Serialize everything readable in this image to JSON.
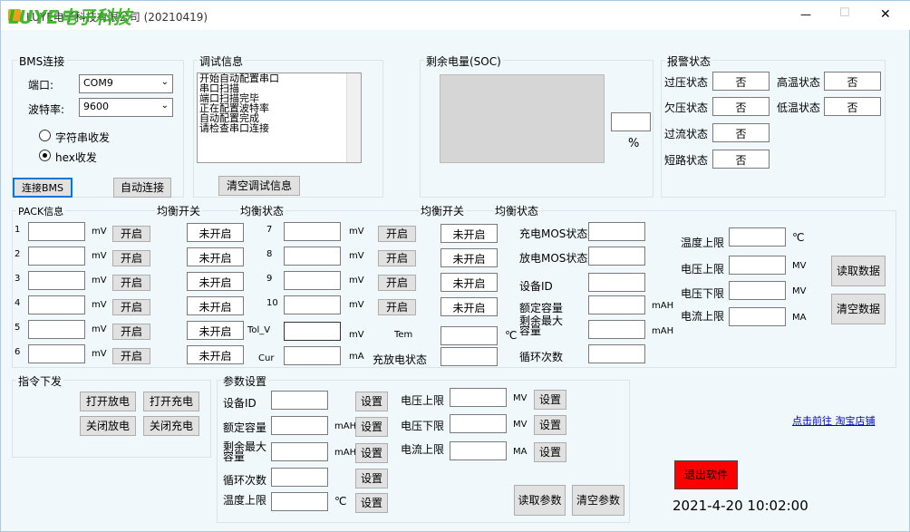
{
  "title": {
    "text": "LUYE电子科技有限公司 (20210419)",
    "watermark": "LUYE电子科技"
  },
  "window_controls": {
    "minimize": "—",
    "maximize": "☐",
    "close": "✕"
  },
  "bms": {
    "label": "BMS连接",
    "port_label": "端口:",
    "port_value": "COM9",
    "baud_label": "波特率:",
    "baud_value": "9600",
    "radio_string": "字符串收发",
    "radio_hex": "hex收发",
    "connect": "连接BMS",
    "auto_connect": "自动连接"
  },
  "debug": {
    "label": "调试信息",
    "lines": [
      "开始自动配置串口",
      "串口扫描",
      "端口扫描完毕",
      "正在配置波特率",
      "自动配置完成",
      "请检查串口连接"
    ],
    "clear": "清空调试信息"
  },
  "soc": {
    "label": "剩余电量(SOC)",
    "unit": "%"
  },
  "alarm": {
    "label": "报警状态",
    "overvolt": "过压状态",
    "overvolt_v": "否",
    "hightemp": "高温状态",
    "hightemp_v": "否",
    "undervolt": "欠压状态",
    "undervolt_v": "否",
    "lowtemp": "低温状态",
    "lowtemp_v": "否",
    "overcurr": "过流状态",
    "overcurr_v": "否",
    "short": "短路状态",
    "short_v": "否"
  },
  "pack": {
    "label": "PACK信息",
    "balance_switch": "均衡开关",
    "balance_state": "均衡状态",
    "unit_mv": "mV",
    "unit_ma": "mA",
    "on": "开启",
    "off_state": "未开启",
    "left_nums": [
      "1",
      "2",
      "3",
      "4",
      "5",
      "6"
    ],
    "right_nums": [
      "7",
      "8",
      "9",
      "10"
    ],
    "tol": "Tol_V",
    "cur": "Cur",
    "tem": "Tem",
    "tem_unit": "℃",
    "charge_state": "充放电状态",
    "charge_mos": "充电MOS状态",
    "discharge_mos": "放电MOS状态",
    "device_id": "设备ID",
    "rated": "额定容量",
    "remain": "剩余最大容量",
    "remain1": "剩余最大",
    "remain2": "容量",
    "cycles": "循环次数",
    "mah": "mAH",
    "temp_upper": "温度上限",
    "temp_unit": "℃",
    "volt_upper": "电压上限",
    "volt_lower": "电压下限",
    "curr_upper": "电流上限",
    "mv": "MV",
    "ma": "MA",
    "read": "读取数据",
    "clear": "清空数据"
  },
  "cmd": {
    "label": "指令下发",
    "open_discharge": "打开放电",
    "open_charge": "打开充电",
    "close_discharge": "关闭放电",
    "close_charge": "关闭充电"
  },
  "param": {
    "label": "参数设置",
    "device_id": "设备ID",
    "rated": "额定容量",
    "remain1": "剩余最大",
    "remain2": "容量",
    "cycles": "循环次数",
    "temp_upper": "温度上限",
    "mah": "mAH",
    "temp_unit": "℃",
    "set": "设置",
    "volt_upper": "电压上限",
    "volt_lower": "电压下限",
    "curr_upper": "电流上限",
    "mv": "MV",
    "ma": "MA",
    "read": "读取参数",
    "clear": "清空参数"
  },
  "link": "点击前往 淘宝店铺",
  "exit": "退出软件",
  "datetime": "2021-4-20 10:02:00",
  "colors": {
    "exit_bg": "#ff0000",
    "link": "#0000cc",
    "watermark": "#2fb31a"
  }
}
